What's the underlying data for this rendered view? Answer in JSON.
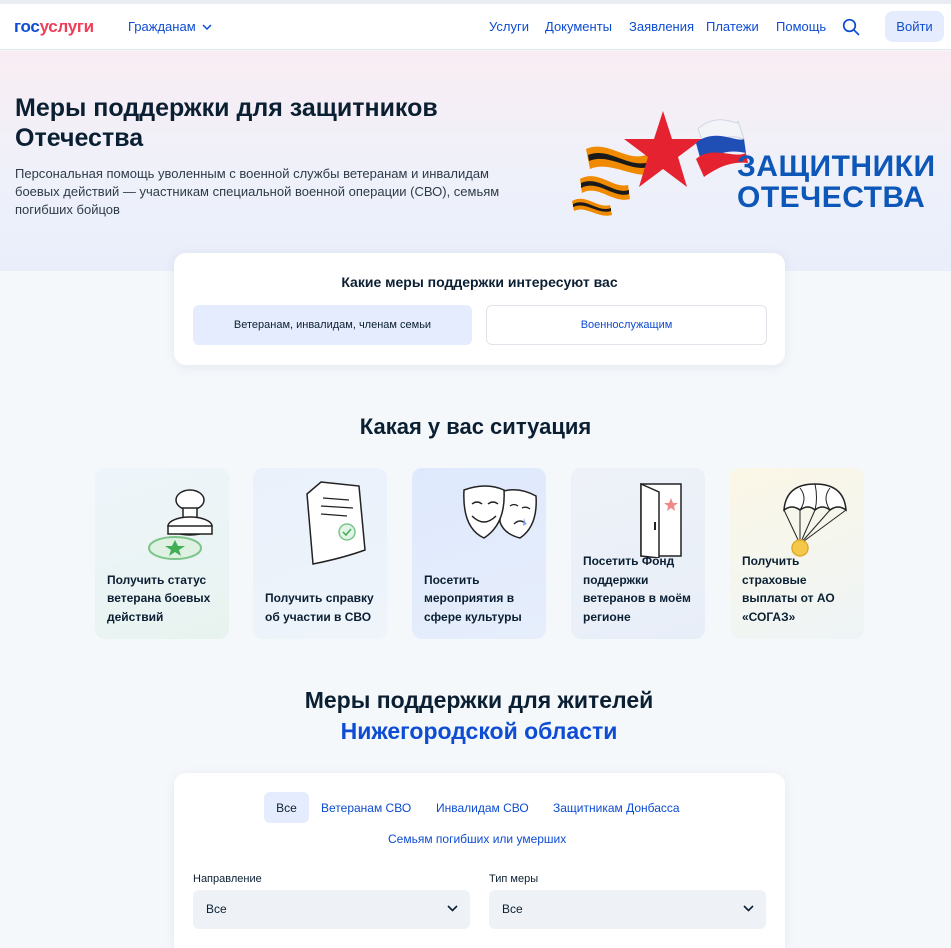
{
  "header": {
    "logo_part1": "гос",
    "logo_part2": "услуги",
    "role_label": "Гражданам",
    "nav": [
      "Услуги",
      "Документы",
      "Заявления",
      "Платежи",
      "Помощь"
    ],
    "login_label": "Войти"
  },
  "hero": {
    "title": "Меры поддержки для защитников Отечества",
    "description": "Персональная помощь уволенным с военной службы ветеранам и инвалидам боевых действий — участникам специальной военной операции (СВО), семьям погибших бойцов",
    "emblem_line1": "ЗАЩИТНИКИ",
    "emblem_line2": "ОТЕЧЕСТВА"
  },
  "support_type": {
    "title": "Какие меры поддержки интересуют вас",
    "options": [
      "Ветеранам, инвалидам, членам семьи",
      "Военнослужащим"
    ]
  },
  "situation": {
    "title": "Какая у вас ситуация",
    "tiles": [
      "Получить статус ветерана боевых действий",
      "Получить справку об участии в СВО",
      "Посетить мероприятия в сфере культуры",
      "Посетить Фонд поддержки ветеранов в моём регионе",
      "Получить страховые выплаты от АО «СОГАЗ»"
    ]
  },
  "region": {
    "title_line1": "Меры поддержки для жителей",
    "title_line2": "Нижегородской области",
    "tabs": [
      "Все",
      "Ветеранам СВО",
      "Инвалидам СВО",
      "Защитникам Донбасса",
      "Семьям погибших или умерших"
    ],
    "direction_label": "Направление",
    "direction_value": "Все",
    "measure_label": "Тип меры",
    "measure_value": "Все"
  },
  "colors": {
    "brand_blue": "#0d4cd3",
    "brand_red": "#ee3f58",
    "emblem_blue": "#0d57b8"
  }
}
